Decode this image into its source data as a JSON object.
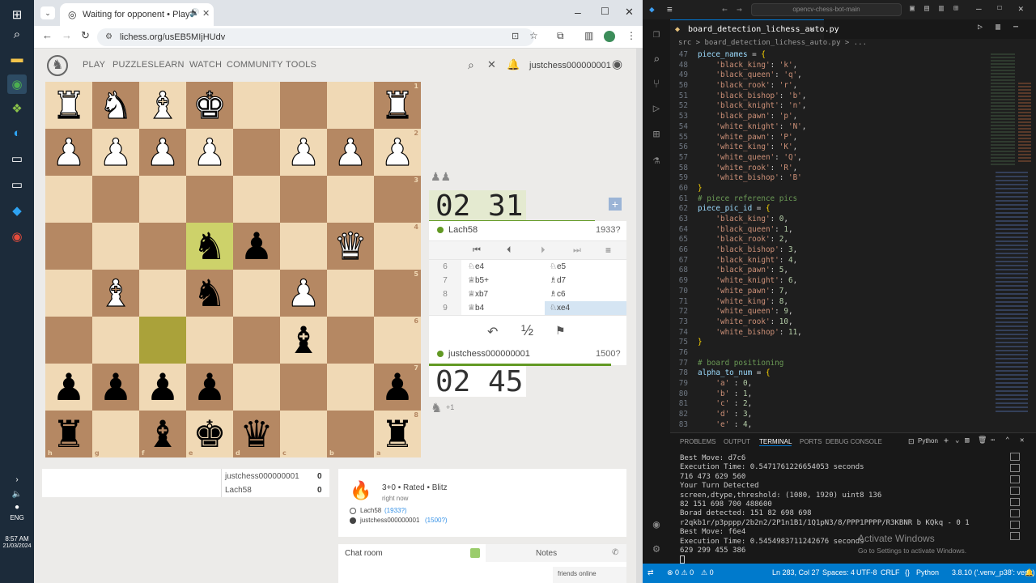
{
  "taskbar": {
    "time": "8:57 AM",
    "date": "21/03/2024",
    "lang": "ENG"
  },
  "browser": {
    "tab_title": "Waiting for opponent • Play",
    "url": "lichess.org/usEB5MIjHUdv"
  },
  "lichess": {
    "nav": [
      "PLAY",
      "PUZZLES",
      "LEARN",
      "WATCH",
      "COMMUNITY",
      "TOOLS"
    ],
    "username": "justchess000000001"
  },
  "board": {
    "files": [
      "h",
      "g",
      "f",
      "e",
      "d",
      "c",
      "b",
      "a"
    ],
    "ranks": [
      "1",
      "2",
      "3",
      "4",
      "5",
      "6",
      "7",
      "8"
    ]
  },
  "game": {
    "top_clock": "02 31",
    "bottom_clock": "02 45",
    "opponent": "Lach58",
    "opponent_rating": "1933?",
    "player": "justchess000000001",
    "player_rating": "1500?",
    "plus": "+1",
    "draw": "½",
    "moves": [
      {
        "n": "6",
        "w": "♘e4",
        "b": "♘e5"
      },
      {
        "n": "7",
        "w": "♕b5+",
        "b": "♗d7"
      },
      {
        "n": "8",
        "w": "♕xb7",
        "b": "♗c6"
      },
      {
        "n": "9",
        "w": "♕b4",
        "b": "♘xe4"
      }
    ]
  },
  "score": {
    "p1": "justchess000000001",
    "p1score": "0",
    "p2": "Lach58",
    "p2score": "0"
  },
  "info": {
    "mode": "3+0 • Rated • Blitz",
    "when": "right now",
    "p1": "Lach58",
    "p1r": "(1933?)",
    "p2": "justchess000000001",
    "p2r": "(1500?)"
  },
  "chat": {
    "room": "Chat room",
    "notes": "Notes",
    "friends": "friends online"
  },
  "vscode": {
    "tab": "board_detection_lichess_auto.py",
    "search": "opencv-chess-bot-main",
    "breadcrumb": "src > board_detection_lichess_auto.py > ...",
    "panel_tabs": [
      "PROBLEMS",
      "OUTPUT",
      "TERMINAL",
      "PORTS",
      "DEBUG CONSOLE"
    ],
    "panel_lang": "Python",
    "terminal": [
      "Best Move: d7c6",
      "Execution Time: 0.5471761226654053 seconds",
      "716 473 629 560",
      "Your Turn Detected",
      "screen,dtype,threshold: (1080, 1920) uint8 136",
      "82 151 698 700 488600",
      "Borad detected: 151 82 698 698",
      "r2qkb1r/p3pppp/2b2n2/2P1n1B1/1Q1pN3/8/PPP1PPPP/R3KBNR b KQkq - 0 1",
      "Best Move: f6e4",
      "Execution Time: 0.5454983711242676 seconds",
      "629 299 455 386"
    ],
    "watermark1": "Activate Windows",
    "watermark2": "Go to Settings to activate Windows.",
    "status": {
      "errors": "⊗ 0 ⚠ 0",
      "warn": "⚠ 0",
      "pos": "Ln 283, Col 27",
      "spaces": "Spaces: 4",
      "enc": "UTF-8",
      "eol": "CRLF",
      "lang": "Python",
      "ver": "3.8.10 ('.venv_p38': venv)"
    }
  }
}
